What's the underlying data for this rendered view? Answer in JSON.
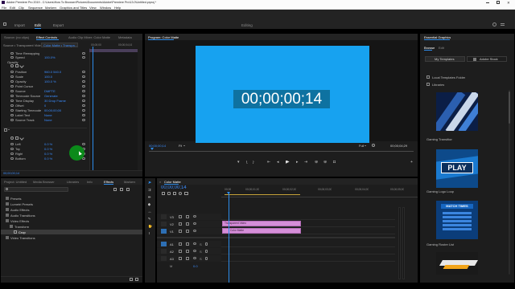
{
  "window": {
    "title": "Adobe Premiere Pro 2019 - C:\\Users\\How To Browser\\Pictures\\Documents\\Adobe\\Premiere Pro\\13.0\\Untitled.prproj *"
  },
  "menu": [
    "File",
    "Edit",
    "Clip",
    "Sequence",
    "Markers",
    "Graphics and Titles",
    "View",
    "Window",
    "Help"
  ],
  "workspace_tabs": [
    {
      "label": "Learning"
    },
    {
      "label": "Assembly"
    },
    {
      "label": "Editing",
      "active": true
    },
    {
      "label": "Color"
    },
    {
      "label": "Effects"
    },
    {
      "label": "Audio"
    },
    {
      "label": "Graphics"
    },
    {
      "label": "Libraries"
    }
  ],
  "header_bar": {
    "import": "Import",
    "edit": "Edit",
    "export": "Export",
    "center_label": "Editing"
  },
  "source_tabs": [
    "Source: (no clips)",
    "Effect Controls",
    "Audio Clip Mixer: Color Matte",
    "Metadata"
  ],
  "program_tab": "Program: Color Matte",
  "essential_graphics_tab": "Essential Graphics",
  "effect_controls": {
    "source_line": "Source • Transparent Video",
    "clip_line": "Color Matte • Transpa...",
    "timecodes": [
      "00;00;00",
      "00;00;04;16"
    ],
    "opacity_title": "Opacity",
    "rows": [
      {
        "label": "Time Remapping",
        "value": ""
      },
      {
        "label": "Speed",
        "value": "100.0%"
      },
      {
        "label": "Position",
        "value": "960.0   540.0"
      },
      {
        "label": "Scale",
        "value": "100.0"
      },
      {
        "label": "Opacity",
        "value": "100.0 %"
      },
      {
        "label": "Point Cursor",
        "value": ""
      },
      {
        "label": "Source",
        "value": "DMFTE"
      },
      {
        "label": "Timecode Source",
        "value": "Generate"
      },
      {
        "label": "Time Display",
        "value": "30 Drop Frame"
      },
      {
        "label": "Offset",
        "value": "0"
      },
      {
        "label": "Starting Timecode",
        "value": "00;00;00;00"
      },
      {
        "label": "Label Text",
        "value": "None"
      },
      {
        "label": "Source Track",
        "value": "None"
      },
      {
        "label": "Left",
        "value": "0.0 %"
      },
      {
        "label": "Top",
        "value": "0.0 %"
      },
      {
        "label": "Right",
        "value": "0.0 %"
      },
      {
        "label": "Bottom",
        "value": "0.0 %"
      }
    ],
    "footer_timecode": "00;00;00;14"
  },
  "program_monitor": {
    "overlay_timecode": "00;00;00;14",
    "current_timecode": "00;00;00;14",
    "fit": "Fit",
    "full": "Full",
    "duration": "00;00;04;29"
  },
  "project_tabs": [
    "Project: Untitled",
    "Media Browser",
    "Libraries",
    "Info",
    "Effects",
    "Markers"
  ],
  "effects_tree": [
    {
      "label": "Presets",
      "indent": 0
    },
    {
      "label": "Lumetri Presets",
      "indent": 0
    },
    {
      "label": "Audio Effects",
      "indent": 0
    },
    {
      "label": "Audio Transitions",
      "indent": 0
    },
    {
      "label": "Video Effects",
      "indent": 0
    },
    {
      "label": "Transform",
      "indent": 1
    },
    {
      "label": "Crop",
      "indent": 2,
      "selected": true
    },
    {
      "label": "Video Transitions",
      "indent": 0
    }
  ],
  "timeline": {
    "tab": "Color Matte",
    "timecode": "00;00;00;14",
    "ruler": [
      "00;00",
      "00;00;01;00",
      "00;00;02;00",
      "00;00;03;00",
      "00;00;04;00",
      "00;00;05;00"
    ],
    "tracks": [
      {
        "name": "V3"
      },
      {
        "name": "V2"
      },
      {
        "name": "V1"
      },
      {
        "name": "A1"
      },
      {
        "name": "A2"
      },
      {
        "name": "A3"
      }
    ],
    "clips": [
      {
        "label": "Transparent Video"
      },
      {
        "label": "Color Matte"
      }
    ],
    "master": "0.0"
  },
  "essential_graphics": {
    "tabs": [
      "Browse",
      "Edit"
    ],
    "my_templates": "My Templates",
    "adobe_stock": "Adobe Stock",
    "local_templates": "Local Templates Folder",
    "libraries": "Libraries",
    "templates": [
      {
        "label": "Gaming Transition"
      },
      {
        "label": "Gaming Logo Loop",
        "text": "PLAY"
      },
      {
        "label": "Gaming Roster List",
        "text": "MATCH TIMES"
      },
      {
        "label": "Gaming Lower Third"
      }
    ]
  },
  "colors": {
    "accent": "#2d8ceb",
    "matte": "#17a2f0",
    "clip": "#d58ed8",
    "cursor": "#0b8a1a"
  }
}
